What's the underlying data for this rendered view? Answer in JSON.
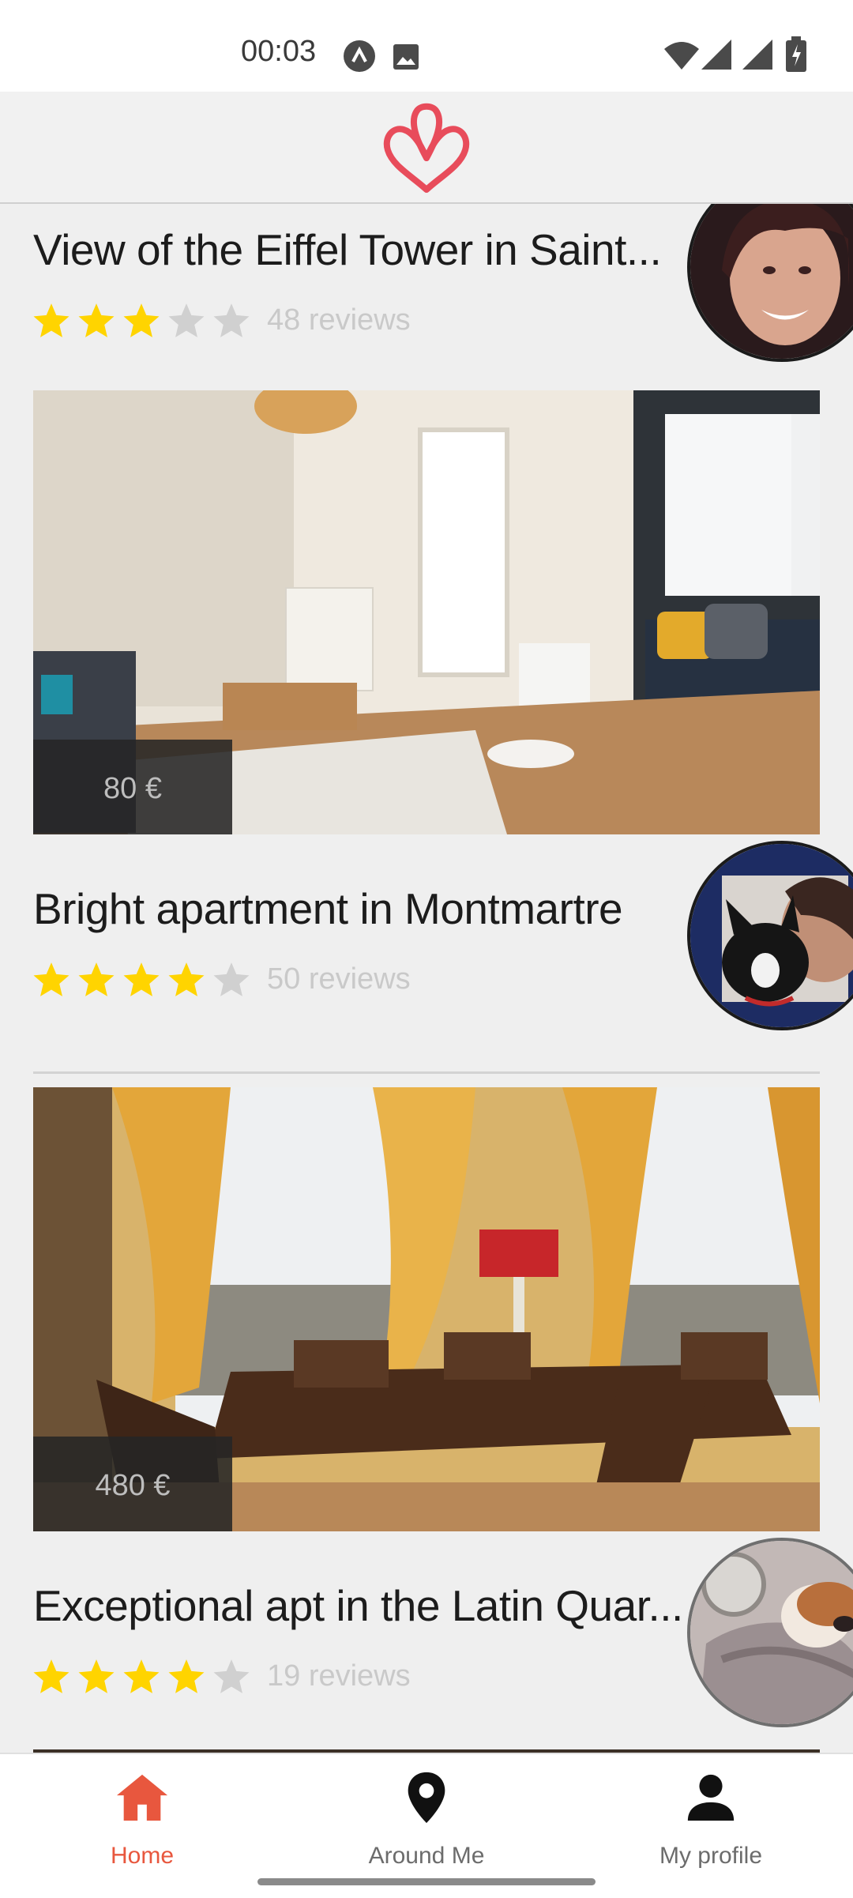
{
  "status_bar": {
    "time": "00:03"
  },
  "colors": {
    "brand": "#ff5a5f",
    "accent": "#e8573e",
    "star_filled": "#ffd400",
    "star_empty": "#d0d0d0"
  },
  "listings": [
    {
      "title": "View of the Eiffel Tower in Saint...",
      "rating": 3,
      "reviews": "48 reviews",
      "price": ""
    },
    {
      "title": "Bright apartment in Montmartre",
      "rating": 4,
      "reviews": "50 reviews",
      "price": "80 €"
    },
    {
      "title": "Exceptional apt in the Latin Quar...",
      "rating": 4,
      "reviews": "19 reviews",
      "price": "480 €"
    }
  ],
  "bottom_nav": [
    {
      "label": "Home",
      "icon": "home-icon",
      "active": true
    },
    {
      "label": "Around Me",
      "icon": "map-pin-icon",
      "active": false
    },
    {
      "label": "My profile",
      "icon": "person-icon",
      "active": false
    }
  ]
}
